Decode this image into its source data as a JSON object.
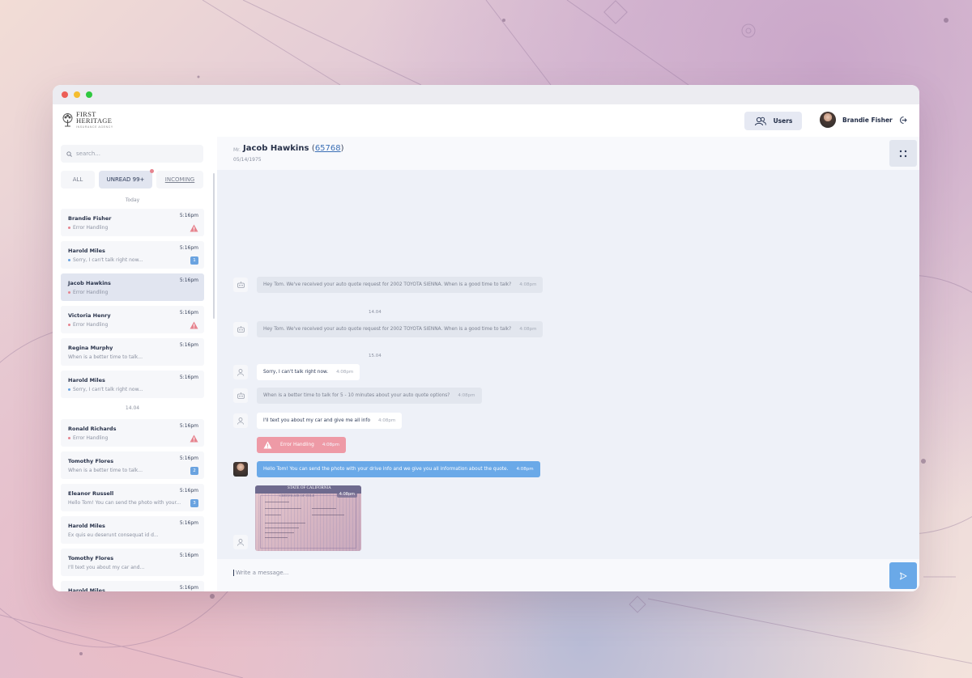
{
  "window": {
    "dots": [
      "#ec5f57",
      "#f5bd2f",
      "#2fc840"
    ]
  },
  "header": {
    "logo_line1": "FIRST",
    "logo_line2": "HERITAGE",
    "logo_sub": "INSURANCE AGENCY",
    "users_label": "Users",
    "profile_name": "Brandie Fisher"
  },
  "sidebar": {
    "search_placeholder": "search...",
    "filters": [
      {
        "label": "ALL",
        "active": false
      },
      {
        "label": "UNREAD 99+",
        "active": true
      },
      {
        "label": "INCOMING",
        "active": false
      }
    ],
    "groups": [
      {
        "day": "Today",
        "items": [
          {
            "name": "Brandie Fisher",
            "preview": "Error Handling",
            "time": "5:16pm",
            "dot": "#e6848f",
            "indicator": "warning"
          },
          {
            "name": "Harold Miles",
            "preview": "Sorry, I can't talk right now...",
            "time": "5:16pm",
            "dot": "#6aa3e0",
            "indicator": "badge",
            "count": "1"
          },
          {
            "name": "Jacob Hawkins",
            "preview": "Error Handling",
            "time": "5:16pm",
            "dot": "#e6848f",
            "indicator": "none",
            "selected": true
          },
          {
            "name": "Victoria Henry",
            "preview": "Error Handling",
            "time": "5:16pm",
            "dot": "#e6848f",
            "indicator": "warning"
          },
          {
            "name": "Regina Murphy",
            "preview": "When is a better time to talk...",
            "time": "5:16pm",
            "indicator": "none"
          },
          {
            "name": "Harold Miles",
            "preview": "Sorry, I can't talk right now...",
            "time": "5:16pm",
            "dot": "#6aa3e0",
            "indicator": "none"
          }
        ]
      },
      {
        "day": "14.04",
        "items": [
          {
            "name": "Ronald Richards",
            "preview": "Error Handling",
            "time": "5:16pm",
            "dot": "#e6848f",
            "indicator": "warning"
          },
          {
            "name": "Tomothy Flores",
            "preview": "When is a better time to talk...",
            "time": "5:16pm",
            "indicator": "badge",
            "count": "2"
          },
          {
            "name": "Eleanor Russell",
            "preview": "Hello Tom! You can send the photo with your...",
            "time": "5:16pm",
            "indicator": "badge",
            "count": "3"
          },
          {
            "name": "Harold Miles",
            "preview": "Ex quis eu deserunt consequat id d...",
            "time": "5:16pm",
            "indicator": "none"
          },
          {
            "name": "Tomothy Flores",
            "preview": "I'll text you about my car and...",
            "time": "5:16pm",
            "indicator": "none"
          },
          {
            "name": "Harold Miles",
            "preview": "",
            "time": "5:16pm",
            "indicator": "none"
          }
        ]
      }
    ]
  },
  "chat": {
    "prefix": "Mr.",
    "name": "Jacob Hawkins",
    "id": "65768",
    "dob": "05/14/1975",
    "messages": [
      {
        "kind": "bot",
        "text": "Hey Tom. We've received your auto quote request for 2002 TOYOTA SIENNA. When is a good time to talk?",
        "time": "4:08pm"
      },
      {
        "kind": "sep",
        "text": "14.04"
      },
      {
        "kind": "bot",
        "text": "Hey Tom. We've received your auto quote request for 2002 TOYOTA SIENNA. When is a good time to talk?",
        "time": "4:08pm"
      },
      {
        "kind": "sep",
        "text": "15.04"
      },
      {
        "kind": "user",
        "text": "Sorry, I can't talk right now.",
        "time": "4:08pm"
      },
      {
        "kind": "bot",
        "text": "When is a better time to talk for 5 - 10 minutes about your auto quote options?",
        "time": "4:08pm"
      },
      {
        "kind": "user",
        "text": "I'll text you about my car and give me all info",
        "time": "4:08pm"
      },
      {
        "kind": "error",
        "text": "Error Handling",
        "time": "4:08pm"
      },
      {
        "kind": "agent",
        "text": "Hello Tom! You can send the photo with your drive info and we give you all information about the quote.",
        "time": "4:08pm"
      }
    ],
    "attachment": {
      "title": "STATE OF CALIFORNIA",
      "subtitle": "CERTIFICATE OF TITLE",
      "time": "4:08pm"
    },
    "composer_placeholder": "Write a message..."
  },
  "colors": {
    "accent": "#6aa9e8",
    "error": "#ee9aa6",
    "selected": "#e1e5f0"
  }
}
